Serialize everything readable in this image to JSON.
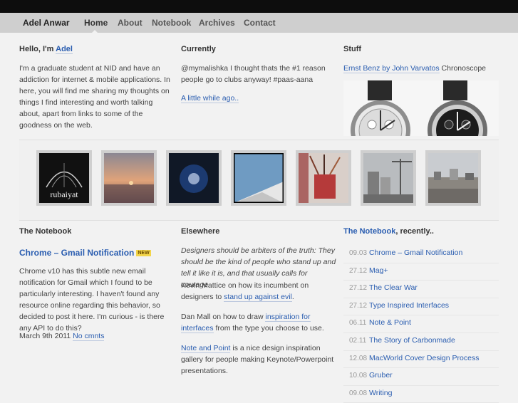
{
  "nav": {
    "brand": "Adel Anwar",
    "items": [
      "Home",
      "About",
      "Notebook",
      "Archives",
      "Contact"
    ]
  },
  "hello": {
    "heading_prefix": "Hello, I'm",
    "heading_link": "Adel",
    "body": "I'm a graduate student at NID and have an addiction for internet & mobile applications. In here, you will find me sharing my thoughts on things I find interesting and worth talking about, apart from links to some of the goodness on the web."
  },
  "currently": {
    "heading": "Currently",
    "tweet": "@mymalishka I thought thats the #1 reason people go to clubs anyway! #paas-aana",
    "when": "A little while ago.."
  },
  "stuff": {
    "heading": "Stuff",
    "link": "Ernst Benz by John Varvatos",
    "suffix": "Chronoscope"
  },
  "gallery": {
    "thumb1_text": "rubaiyat"
  },
  "notebook": {
    "heading": "The Notebook",
    "post_title": "Chrome – Gmail Notification",
    "badge": "NEW",
    "excerpt": "Chrome v10 has this subtle new email notification for Gmail which I found to be particularly interesting. I haven't found any resource online regarding this behavior, so decided to post it here. I'm curious - is there any API to do this?",
    "date": "March 9th 2011",
    "comments": "No cmnts"
  },
  "elsewhere": {
    "heading": "Elsewhere",
    "quote": "Designers should be arbiters of the truth: They should be the kind of people who stand up and tell it like it is, and that usually calls for courage.",
    "item1_pre": "Kevin Mattice on how its incumbent on designers to",
    "item1_link": "stand up against evil",
    "item1_post": ".",
    "item2_pre": "Dan Mall on how to draw",
    "item2_link": "inspiration for interfaces",
    "item2_post": "from the type you choose to use.",
    "item3_link": "Note and Point",
    "item3_post": "is a nice design inspiration gallery for people making Keynote/Powerpoint presentations."
  },
  "recent": {
    "heading_link": "The Notebook",
    "heading_suffix": ", recently..",
    "items": [
      {
        "date": "09.03",
        "title": "Chrome – Gmail Notification"
      },
      {
        "date": "27.12",
        "title": "Mag+"
      },
      {
        "date": "27.12",
        "title": "The Clear War"
      },
      {
        "date": "27.12",
        "title": "Type Inspired Interfaces"
      },
      {
        "date": "06.11",
        "title": "Note & Point"
      },
      {
        "date": "02.11",
        "title": "The Story of Carbonmade"
      },
      {
        "date": "12.08",
        "title": "MacWorld Cover Design Process"
      },
      {
        "date": "10.08",
        "title": "Gruber"
      },
      {
        "date": "09.08",
        "title": "Writing"
      }
    ]
  }
}
